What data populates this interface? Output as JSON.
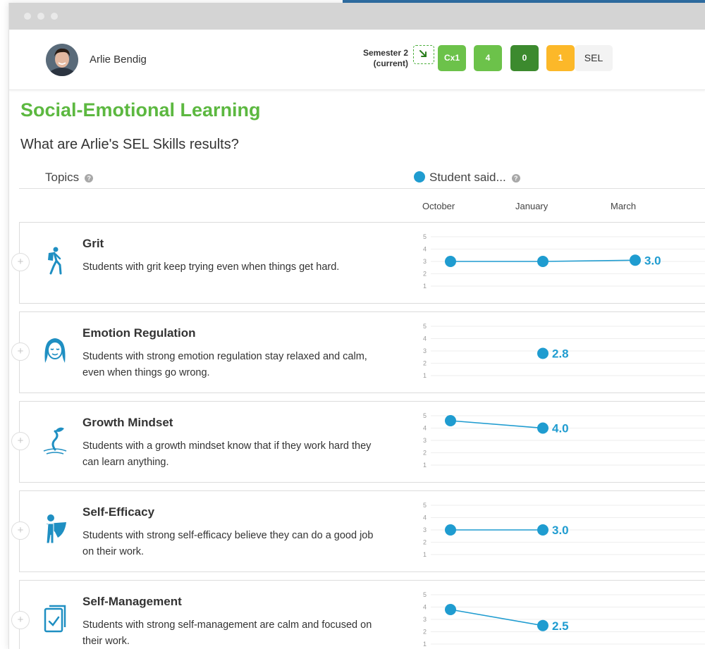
{
  "student": {
    "name": "Arlie Bendig"
  },
  "header": {
    "semester_line1": "Semester 2",
    "semester_line2": "(current)",
    "badges": [
      {
        "label": "Cx1",
        "color": "#6cc24a"
      },
      {
        "label": "4",
        "color": "#6cc24a"
      },
      {
        "label": "0",
        "color": "#3c8a2e"
      },
      {
        "label": "1",
        "color": "#fcb829"
      },
      {
        "label": "SEL",
        "color": "#f3f3f3"
      }
    ]
  },
  "page": {
    "title": "Social-Emotional Learning",
    "question": "What are Arlie's SEL Skills results?",
    "topics_header": "Topics",
    "legend_label": "Student said...",
    "help_glyph": "?",
    "months": [
      "October",
      "January",
      "March"
    ]
  },
  "colors": {
    "accent_green": "#5cb840",
    "series_blue": "#1f9cd0"
  },
  "topics": [
    {
      "title": "Grit",
      "description": "Students with grit keep trying even when things get hard.",
      "icon": "hiker-icon",
      "chart_data": {
        "type": "line",
        "x": [
          "October",
          "January",
          "March"
        ],
        "y": [
          3.0,
          3.0,
          3.1
        ],
        "label": "3.0",
        "ylim": [
          1,
          5
        ]
      }
    },
    {
      "title": "Emotion Regulation",
      "description": "Students with strong emotion regulation stay relaxed and calm, even when things go wrong.",
      "icon": "calm-face-icon",
      "chart_data": {
        "type": "line",
        "x": [
          "October",
          "January",
          "March"
        ],
        "y": [
          null,
          2.8,
          null
        ],
        "label": "2.8",
        "ylim": [
          1,
          5
        ]
      }
    },
    {
      "title": "Growth Mindset",
      "description": "Students with a growth mindset know that if they work hard they can learn anything.",
      "icon": "sprout-icon",
      "chart_data": {
        "type": "line",
        "x": [
          "October",
          "January",
          "March"
        ],
        "y": [
          4.6,
          4.0,
          null
        ],
        "label": "4.0",
        "ylim": [
          1,
          5
        ]
      }
    },
    {
      "title": "Self-Efficacy",
      "description": "Students with strong self-efficacy believe they can do a good job on their work.",
      "icon": "superhero-icon",
      "chart_data": {
        "type": "line",
        "x": [
          "October",
          "January",
          "March"
        ],
        "y": [
          3.0,
          3.0,
          null
        ],
        "label": "3.0",
        "ylim": [
          1,
          5
        ]
      }
    },
    {
      "title": "Self-Management",
      "description": "Students with strong self-management are calm and focused on their work.",
      "icon": "checklist-icon",
      "chart_data": {
        "type": "line",
        "x": [
          "October",
          "January",
          "March"
        ],
        "y": [
          3.8,
          2.5,
          null
        ],
        "label": "2.5",
        "ylim": [
          1,
          5
        ]
      }
    }
  ]
}
